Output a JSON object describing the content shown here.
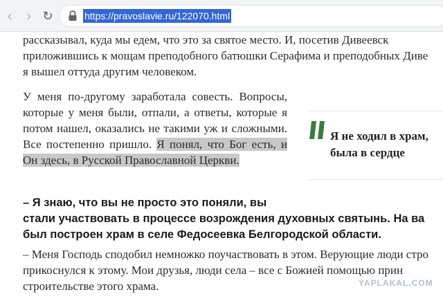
{
  "browser": {
    "url": "https://pravoslavie.ru/122070.html",
    "back_icon": "‹",
    "forward_icon": "›",
    "reload_icon": "↻"
  },
  "article": {
    "intro_lines": [
      "рассказывал, куда мы едем, что это за святое место. И, посетив Дивеевск",
      "приложившись к мощам преподобного батюшки Серафима и преподобных Диве",
      "я вышел оттуда другим человеком."
    ],
    "conscience_text": "У меня по-другому заработала совесть. Вопросы, которые у меня были, отпали, а ответы, которые я потом нашел, оказались не такими уж и сложными. Все постепенно пришло. ",
    "highlighted_text": "Я понял, что Бог есть, и Он здесь, в Русской Православной Церкви.",
    "question_lines": [
      "– Я знаю, что вы не просто это поняли, вы",
      "стали участвовать в процессе возрождения духовных святынь. На ва",
      "был построен храм в селе Федосеевка Белгородской области."
    ],
    "answer_lines": [
      "– Меня Господь сподобил немножко поучаствовать в этом. Верующие люди стро",
      "прикоснулся к этому. Мои друзья, люди села – все с Божией помощью прин",
      "строительстве этого храма."
    ]
  },
  "pull_quote": {
    "lines": [
      "Я не ходил в храм,",
      "была в сердце"
    ],
    "accent_color": "#3a7d3c"
  },
  "watermark": "YAPLAKAL.COM"
}
